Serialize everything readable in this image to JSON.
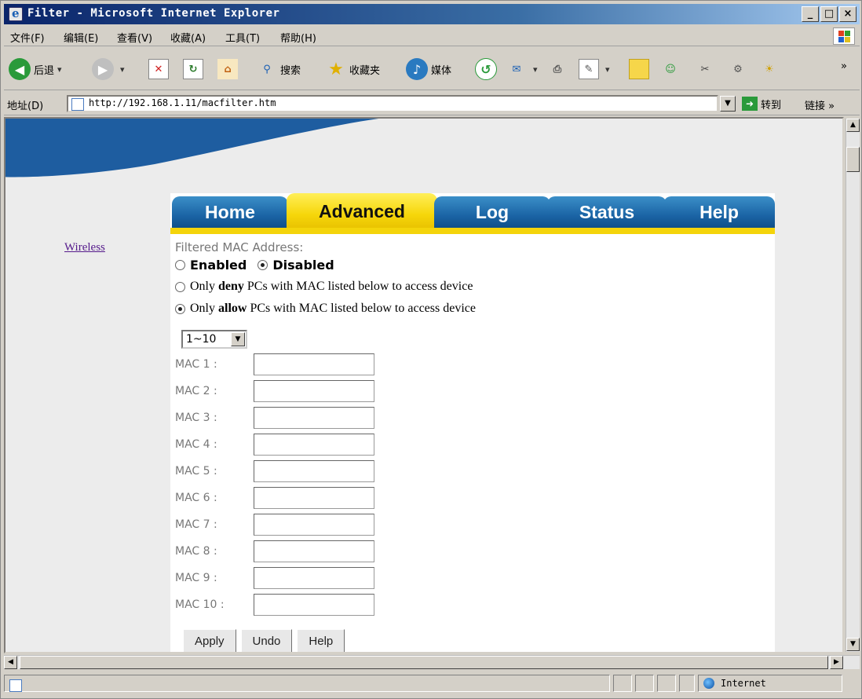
{
  "window": {
    "title": "Filter - Microsoft Internet Explorer",
    "controls": [
      "_",
      "□",
      "×"
    ]
  },
  "menubar": {
    "items": [
      "文件(F)",
      "编辑(E)",
      "查看(V)",
      "收藏(A)",
      "工具(T)",
      "帮助(H)"
    ]
  },
  "toolbar": {
    "back": "后退",
    "search": "搜索",
    "favorites": "收藏夹",
    "media": "媒体",
    "overflow": "»"
  },
  "address": {
    "label": "地址(D)",
    "url": "http://192.168.1.11/macfilter.htm",
    "go": "转到",
    "links": "链接 »"
  },
  "sidebar": {
    "link": "Wireless"
  },
  "tabs": [
    "Home",
    "Advanced",
    "Log",
    "Status",
    "Help"
  ],
  "active_tab": "Advanced",
  "form": {
    "heading": "Filtered MAC Address:",
    "enabled_label": "Enabled",
    "disabled_label": "Disabled",
    "deny": {
      "pre": "Only ",
      "bold": "deny",
      "post": " PCs with MAC listed below to access device"
    },
    "allow": {
      "pre": "Only ",
      "bold": "allow",
      "post": " PCs with MAC listed below to access device"
    },
    "range_select": "1~10",
    "mac_labels": [
      "MAC 1 :",
      "MAC 2 :",
      "MAC 3 :",
      "MAC 4 :",
      "MAC 5 :",
      "MAC 6 :",
      "MAC 7 :",
      "MAC 8 :",
      "MAC 9 :",
      "MAC 10 :"
    ],
    "mac_values": [
      "",
      "",
      "",
      "",
      "",
      "",
      "",
      "",
      "",
      ""
    ]
  },
  "buttons": {
    "apply": "Apply",
    "undo": "Undo",
    "help": "Help"
  },
  "status": {
    "zone": "Internet"
  },
  "colors": {
    "tab_blue": "#1a63a4",
    "tab_yellow": "#f6d60a",
    "link_purple": "#551a8b",
    "titlebar": "#0a246a"
  }
}
